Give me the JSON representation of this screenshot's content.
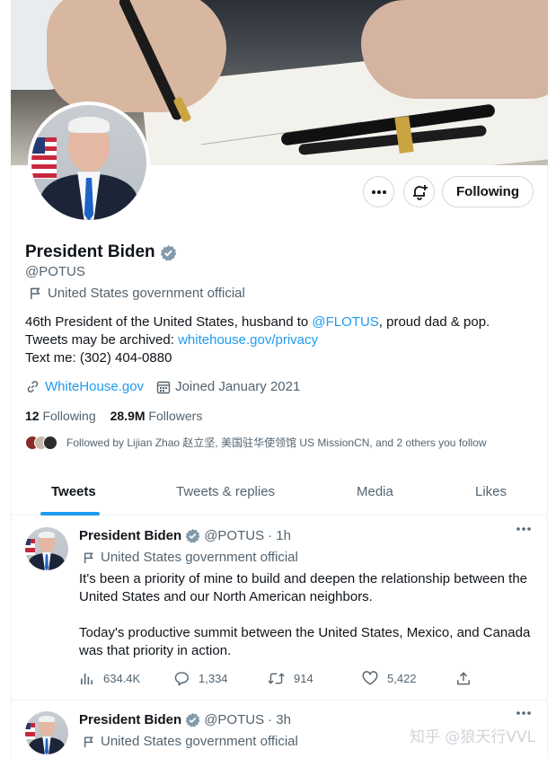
{
  "profile": {
    "name": "President Biden",
    "handle": "@POTUS",
    "gov_label": "United States government official",
    "bio_line1_pre": "46th President of the United States, husband to ",
    "bio_mention": "@FLOTUS",
    "bio_line1_post": ", proud dad & pop.",
    "bio_line2_pre": "Tweets may be archived: ",
    "bio_link": "whitehouse.gov/privacy",
    "bio_line3": "Text me: (302) 404-0880",
    "website": "WhiteHouse.gov",
    "joined": "Joined January 2021",
    "following_count": "12",
    "following_label": "Following",
    "followers_count": "28.9M",
    "followers_label": "Followers",
    "followed_by": "Followed by Lijian Zhao 赵立坚, 美国驻华使领馆 US MissionCN, and 2 others you follow"
  },
  "actions": {
    "following_button": "Following"
  },
  "tabs": [
    "Tweets",
    "Tweets & replies",
    "Media",
    "Likes"
  ],
  "tweets": [
    {
      "name": "President Biden",
      "handle": "@POTUS",
      "time": "· 1h",
      "gov_label": "United States government official",
      "para1": "It's been a priority of mine to build and deepen the relationship between the United States and our North American neighbors.",
      "para2": "Today's productive summit between the United States, Mexico, and Canada was that priority in action.",
      "views": "634.4K",
      "replies": "1,334",
      "retweets": "914",
      "likes": "5,422"
    },
    {
      "name": "President Biden",
      "handle": "@POTUS",
      "time": "· 3h",
      "gov_label": "United States government official"
    }
  ],
  "watermark": "知乎 @狼天行VVL",
  "colors": {
    "accent": "#1d9bf0",
    "verified_badge": "#829aab",
    "muted_text": "#536471"
  }
}
